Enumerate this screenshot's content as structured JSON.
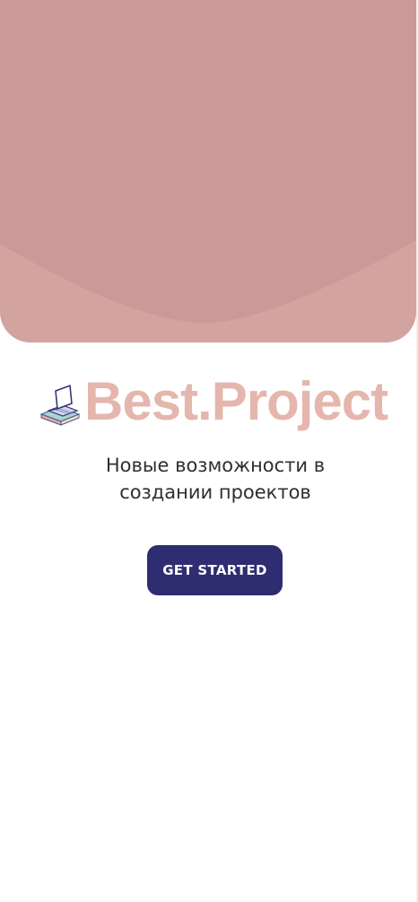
{
  "colors": {
    "hero_light": "#d3a3a0",
    "hero_dark": "#c99a98",
    "logo_text": "#e5b6ad",
    "button_bg": "#2e2d72",
    "button_text": "#ffffff",
    "tagline_text": "#2f2f2f"
  },
  "logo": {
    "icon": "laptop-books-icon",
    "text": "Best.Project"
  },
  "tagline": {
    "line1": "Новые возможности в",
    "line2": "создании проектов"
  },
  "cta": {
    "label": "GET STARTED"
  }
}
